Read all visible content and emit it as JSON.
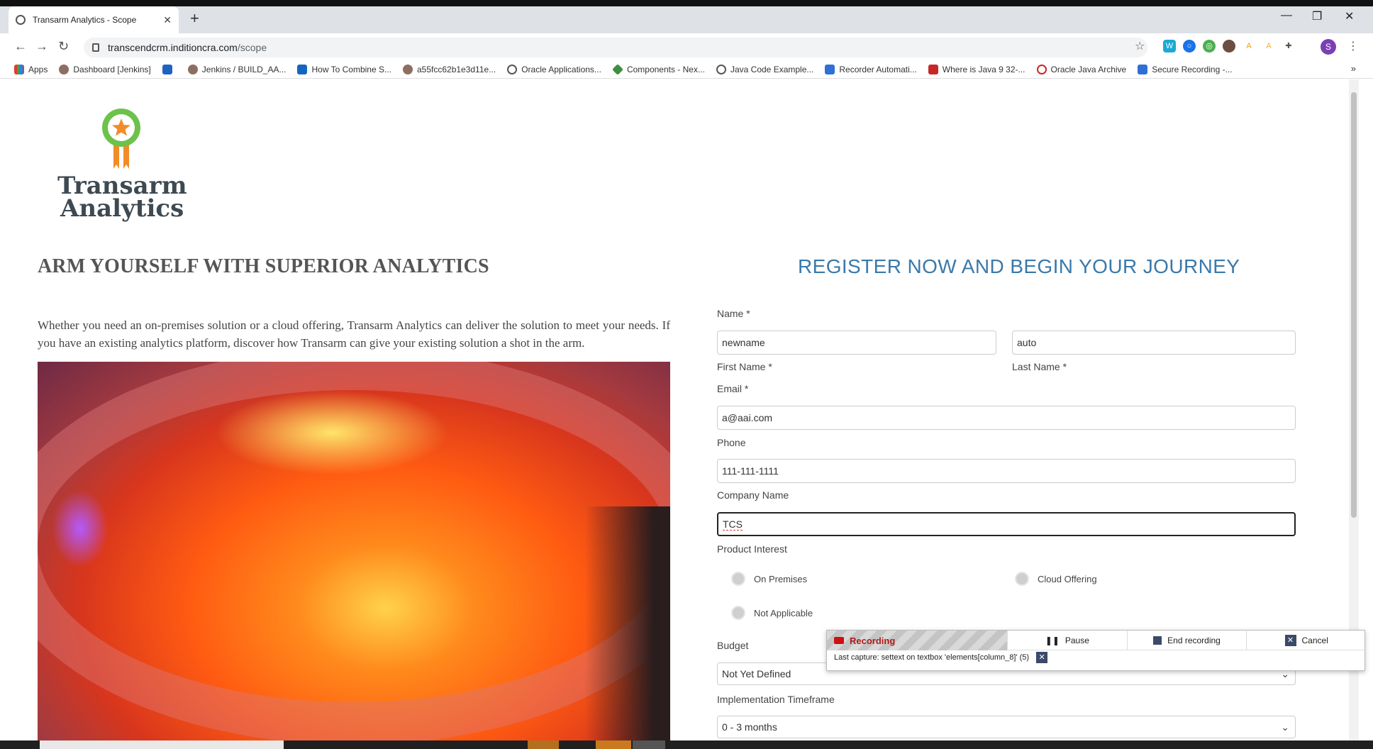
{
  "browser": {
    "tab_title": "Transarm Analytics - Scope",
    "url_host": "transcendcrm.inditioncra.com",
    "url_path": "/scope",
    "profile_initial": "S",
    "bookmarks": [
      "Apps",
      "Dashboard [Jenkins]",
      "",
      "Jenkins / BUILD_AA...",
      "How To Combine S...",
      "a55fcc62b1e3d11e...",
      "Oracle Applications...",
      "Components - Nex...",
      "Java Code Example...",
      "Recorder Automati...",
      "Where is Java 9 32-...",
      "Oracle Java Archive",
      "Secure Recording -..."
    ],
    "bookmarks_more": "»"
  },
  "page": {
    "logo_line1": "Transarm",
    "logo_line2": "Analytics",
    "left_heading": "ARM YOURSELF WITH SUPERIOR ANALYTICS",
    "left_paragraph": "Whether you need an on-premises solution or a cloud offering, Transarm Analytics can deliver the solution to meet your needs. If you have an existing analytics platform, discover how Transarm can give your existing solution a shot in the arm.",
    "right_heading": "REGISTER NOW AND BEGIN YOUR JOURNEY"
  },
  "form": {
    "name_label": "Name *",
    "first_name_value": "newname",
    "last_name_value": "auto",
    "first_name_label": "First Name *",
    "last_name_label": "Last Name *",
    "email_label": "Email *",
    "email_value": "a@aai.com",
    "phone_label": "Phone",
    "phone_value": "111-111-1111",
    "company_label": "Company Name",
    "company_value": "TCS",
    "product_interest_label": "Product Interest",
    "options": [
      "On Premises",
      "Cloud Offering",
      "Not Applicable"
    ],
    "budget_label": "Budget",
    "budget_value": "Not Yet Defined",
    "timeframe_label": "Implementation Timeframe",
    "timeframe_value": "0 - 3 months"
  },
  "recorder": {
    "status": "Recording",
    "pause": "Pause",
    "end": "End recording",
    "cancel": "Cancel",
    "last_capture": "Last capture: settext on textbox 'elements[column_8]' (5)"
  },
  "colors": {
    "heading_blue": "#3a79aa",
    "recording_red": "#b01a1a"
  }
}
